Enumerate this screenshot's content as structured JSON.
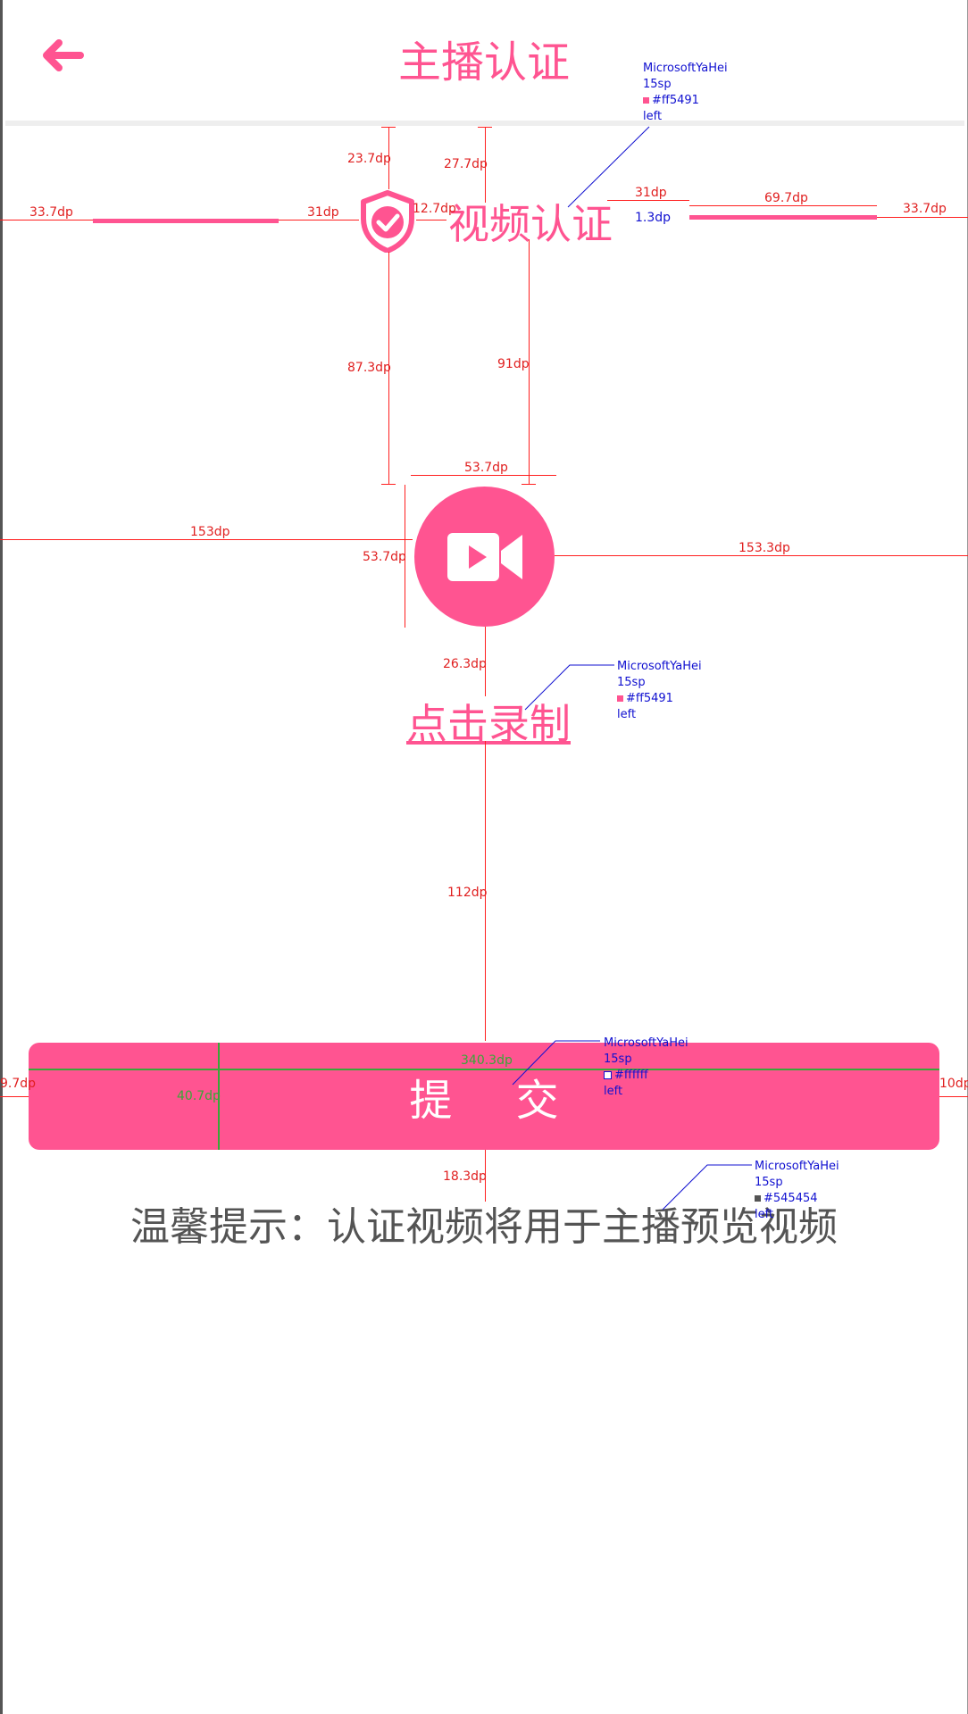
{
  "header": {
    "title": "主播认证"
  },
  "verification": {
    "title": "视频认证"
  },
  "record": {
    "label": "点击录制"
  },
  "submit": {
    "label": "提 交"
  },
  "tip": {
    "text": "温馨提示：认证视频将用于主播预览视频"
  },
  "icons": {
    "back": "back-arrow-icon",
    "shield": "shield-check-icon",
    "camera": "video-camera-icon"
  },
  "colors": {
    "accent": "#ff5491",
    "tip_text": "#545454",
    "button_text": "#ffffff"
  },
  "annotations": {
    "dims": {
      "d1": "23.7dp",
      "d2": "27.7dp",
      "d3": "33.7dp",
      "d4": "31dp",
      "d5": "12.7dp",
      "d6": "31dp",
      "d7": "69.7dp",
      "d8": "33.7dp",
      "d9": "1.3dp",
      "d10": "87.3dp",
      "d11": "91dp",
      "d12": "53.7dp",
      "d13": "153dp",
      "d14": "53.7dp",
      "d15": "153.3dp",
      "d16": "26.3dp",
      "d17": "112dp",
      "d18": "9.7dp",
      "d19": "10dp",
      "d20": "18.3dp",
      "d21": "340.3dp",
      "d22": "40.7dp"
    },
    "spec1": {
      "font": "MicrosoftYaHei",
      "size": "15sp",
      "color": "#ff5491",
      "align": "left"
    },
    "spec2": {
      "font": "MicrosoftYaHei",
      "size": "15sp",
      "color": "#ff5491",
      "align": "left"
    },
    "spec3": {
      "font": "MicrosoftYaHei",
      "size": "15sp",
      "color": "#ffffff",
      "align": "left"
    },
    "spec4": {
      "font": "MicrosoftYaHei",
      "size": "15sp",
      "color": "#545454",
      "align": "left"
    }
  }
}
